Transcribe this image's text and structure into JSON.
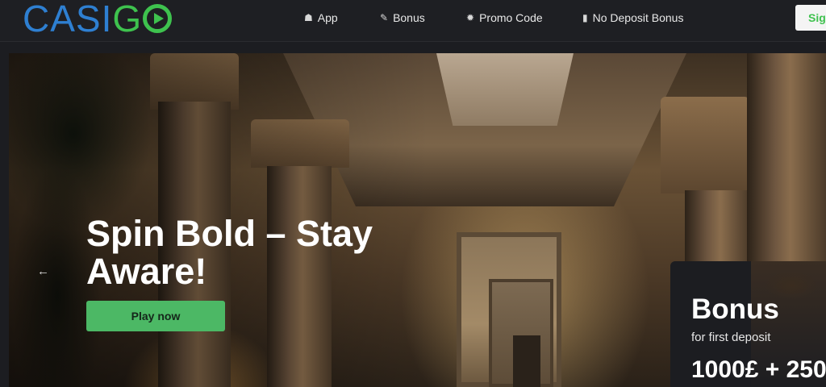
{
  "header": {
    "logo": {
      "part1": "CASI",
      "part2": "G"
    },
    "nav": [
      {
        "label": "App",
        "icon": "app-icon",
        "glyph": "☗"
      },
      {
        "label": "Bonus",
        "icon": "bonus-icon",
        "glyph": "✎"
      },
      {
        "label": "Promo Code",
        "icon": "promo-icon",
        "glyph": "✹"
      },
      {
        "label": "No Deposit Bonus",
        "icon": "phone-icon",
        "glyph": "▮"
      }
    ],
    "signup_label": "Sig"
  },
  "hero": {
    "title": "Spin Bold – Stay Aware!",
    "cta_label": "Play now",
    "prev_arrow": "←"
  },
  "bonus_card": {
    "title": "Bonus",
    "subtitle": "for first deposit",
    "amount": "1000£ + 250"
  },
  "colors": {
    "brand_blue": "#2e7fd1",
    "brand_green": "#3ec24e",
    "cta_green": "#4cb865",
    "header_bg": "#1e1f23"
  }
}
